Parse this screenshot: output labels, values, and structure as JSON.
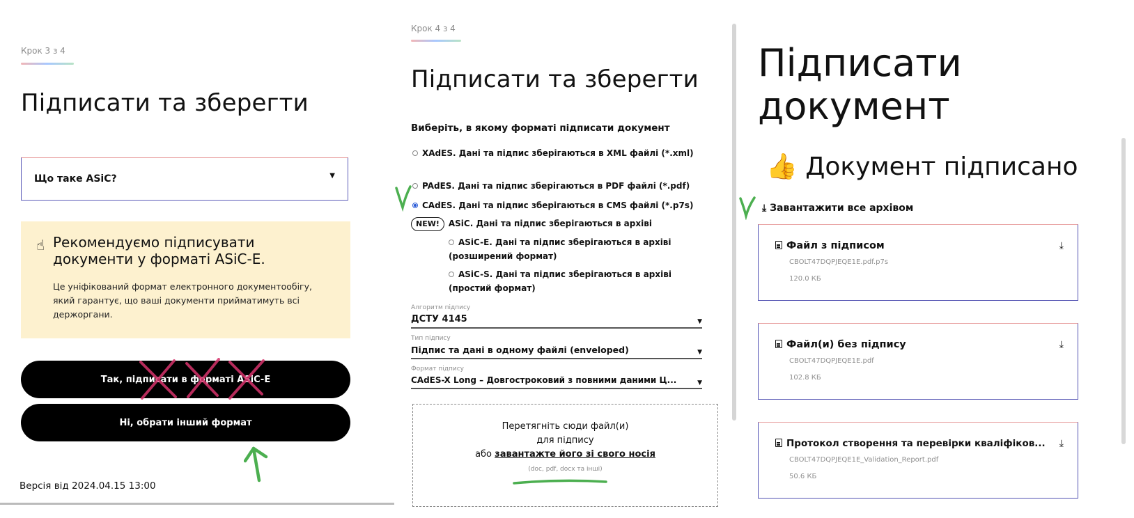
{
  "panel1": {
    "step": "Крок 3 з 4",
    "title": "Підписати та зберегти",
    "accordion_label": "Що таке ASiC?",
    "recommendation": {
      "title": "Рекомендуємо підписувати документи у форматі ASiC-E.",
      "body": "Це уніфікований формат електронного документообігу, який гарантує, що ваші документи прийматимуть всі держоргани."
    },
    "yes_button": "Так, підписати в форматі ASiC-E",
    "no_button": "Ні, обрати інший формат",
    "version": "Версія від 2024.04.15 13:00"
  },
  "panel2": {
    "step": "Крок 4 з 4",
    "title": "Підписати та зберегти",
    "format_heading": "Виберіть, в якому форматі підписати документ",
    "options": {
      "xades": "XAdES. Дані та підпис зберігаються в XML файлі (*.xml)",
      "pades": "PAdES. Дані та підпис зберігаються в PDF файлі (*.pdf)",
      "cades": "CAdES. Дані та підпис зберігаються в CMS файлі (*.p7s)",
      "new_badge": "NEW!",
      "asic": "ASiC. Дані та підпис зберігаються в архіві",
      "asice": "ASiC-E. Дані та підпис зберігаються в архіві (розширений формат)",
      "asics": "ASiC-S. Дані та підпис зберігаються в архіві (простий формат)"
    },
    "selected_option": "cades",
    "algorithm": {
      "caption": "Алгоритм підпису",
      "value": "ДСТУ 4145"
    },
    "sign_type": {
      "caption": "Тип підпису",
      "value": "Підпис та дані в одному файлі (enveloped)"
    },
    "sign_format": {
      "caption": "Формат підпису",
      "value": "CAdES-X Long – Довгостроковий з повними даними Ц..."
    },
    "dropzone": {
      "line1": "Перетягніть сюди файл(и)",
      "line2": "для підпису",
      "line3_prefix": "або ",
      "upload_link": "завантажте його зі свого носія",
      "formats": "(doc, pdf, docx та інші)"
    }
  },
  "panel3": {
    "title_line1": "Підписати",
    "title_line2": "документ",
    "signed_emoji": "👍",
    "signed_text": "Документ підписано",
    "download_all": "Завантажити все архівом",
    "files": [
      {
        "name": "Файл з підписом",
        "filename": "CBOLT47DQPJEQE1E.pdf.p7s",
        "size": "120.0 КБ"
      },
      {
        "name": "Файл(и) без підпису",
        "filename": "CBOLT47DQPJEQE1E.pdf",
        "size": "102.8 КБ"
      },
      {
        "name": "Протокол створення та перевірки кваліфіков...",
        "filename": "CBOLT47DQPJEQE1E_Validation_Report.pdf",
        "size": "50.6 КБ"
      }
    ]
  },
  "colors": {
    "accent_border": "#5151b2",
    "recommend_bg": "#fdf1cf",
    "annotation_pink": "#d6336c",
    "annotation_green": "#4caf50"
  }
}
